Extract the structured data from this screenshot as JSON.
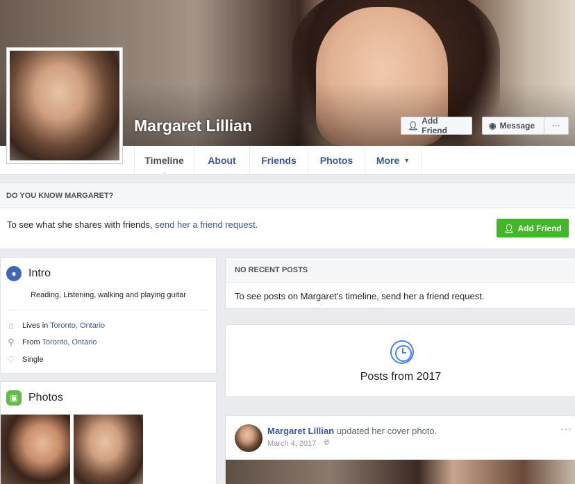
{
  "profile": {
    "name": "Margaret Lillian"
  },
  "actions": {
    "add_friend": "Add Friend",
    "message": "Message",
    "more": "···"
  },
  "tabs": [
    {
      "label": "Timeline"
    },
    {
      "label": "About"
    },
    {
      "label": "Friends"
    },
    {
      "label": "Photos"
    },
    {
      "label": "More"
    }
  ],
  "know": {
    "heading": "DO YOU KNOW MARGARET?",
    "text": "To see what she shares with friends, ",
    "link": "send her a friend request.",
    "button": "Add Friend"
  },
  "intro": {
    "title": "Intro",
    "bio": "Reading, Listening, walking and playing guitar",
    "lives_prefix": "Lives in ",
    "lives_place": "Toronto, Ontario",
    "from_prefix": "From ",
    "from_place": "Toronto, Ontario",
    "relationship": "Single"
  },
  "photos": {
    "title": "Photos"
  },
  "recent": {
    "heading": "NO RECENT POSTS",
    "text": "To see posts on Margaret's timeline, send her a friend request."
  },
  "year_section": {
    "label": "Posts from 2017"
  },
  "post": {
    "author": "Margaret Lillian",
    "action": " updated her cover photo.",
    "date": "March 4, 2017 ·",
    "menu": "···"
  },
  "icons": {
    "add_friend": "add-person-icon",
    "message": "messenger-icon",
    "intro": "globe-icon",
    "photos": "photo-icon",
    "lives": "home-icon",
    "from": "location-pin-icon",
    "relationship": "heart-icon",
    "clock": "clock-icon",
    "privacy": "globe-icon"
  },
  "colors": {
    "link": "#365899",
    "green": "#42b72a",
    "blue": "#4267b2",
    "clock": "#4080ff"
  }
}
